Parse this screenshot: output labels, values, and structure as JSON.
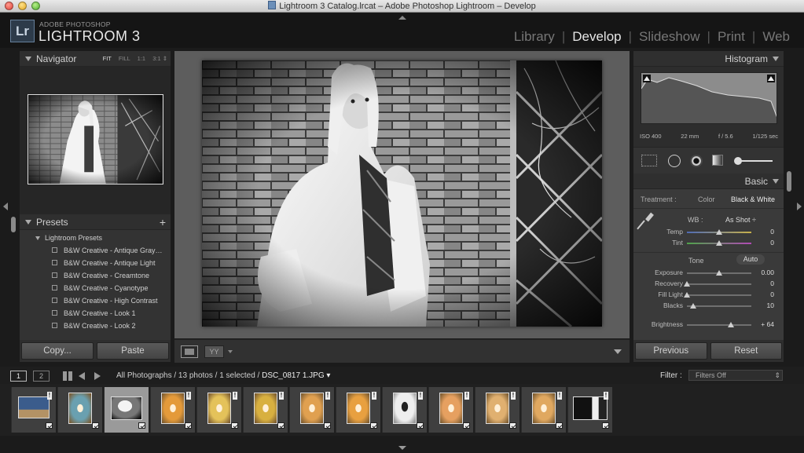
{
  "window": {
    "title": "Lightroom 3 Catalog.lrcat – Adobe Photoshop Lightroom – Develop"
  },
  "brand": {
    "logo": "Lr",
    "top_line": "ADOBE PHOTOSHOP",
    "name": "LIGHTROOM 3"
  },
  "modules": [
    {
      "label": "Library"
    },
    {
      "label": "Develop"
    },
    {
      "label": "Slideshow"
    },
    {
      "label": "Print"
    },
    {
      "label": "Web"
    }
  ],
  "navigator": {
    "title": "Navigator",
    "zoom": [
      "FIT",
      "FILL",
      "1:1",
      "3:1 ⇕"
    ]
  },
  "presets": {
    "title": "Presets",
    "add": "+",
    "group": "Lightroom Presets",
    "items": [
      "B&W Creative - Antique Gray…",
      "B&W Creative - Antique Light",
      "B&W Creative - Creamtone",
      "B&W Creative - Cyanotype",
      "B&W Creative - High Contrast",
      "B&W Creative - Look 1",
      "B&W Creative - Look 2"
    ]
  },
  "left_buttons": {
    "copy": "Copy...",
    "paste": "Paste"
  },
  "right_buttons": {
    "previous": "Previous",
    "reset": "Reset"
  },
  "histogram": {
    "title": "Histogram",
    "iso": "ISO 400",
    "focal": "22 mm",
    "aperture": "f / 5.6",
    "shutter": "1/125 sec"
  },
  "basic": {
    "title": "Basic",
    "treatment_label": "Treatment :",
    "treatment_color": "Color",
    "treatment_bw": "Black & White",
    "wb_label": "WB :",
    "wb_value": "As Shot ÷",
    "tone_label": "Tone",
    "auto_label": "Auto",
    "sliders": [
      {
        "label": "Temp",
        "value": "0",
        "pos": 0.5
      },
      {
        "label": "Tint",
        "value": "0",
        "pos": 0.5
      },
      {
        "label": "Exposure",
        "value": "0.00",
        "pos": 0.5
      },
      {
        "label": "Recovery",
        "value": "0",
        "pos": 0.0
      },
      {
        "label": "Fill Light",
        "value": "0",
        "pos": 0.0
      },
      {
        "label": "Blacks",
        "value": "10",
        "pos": 0.1
      },
      {
        "label": "Brightness",
        "value": "+ 64",
        "pos": 0.68
      }
    ]
  },
  "filmstrip_bar": {
    "screen1": "1",
    "screen2": "2",
    "source": "All Photographs / 13 photos / 1 selected /",
    "filename": "DSC_0817 1.JPG ▾",
    "filter_label": "Filter :",
    "filter_value": "Filters Off"
  },
  "filmstrip": {
    "count": 13,
    "selected_index": 2
  },
  "colors": {
    "accent": "#e6e6e6",
    "panel": "#3a3a3a",
    "background": "#1b1b1b"
  }
}
